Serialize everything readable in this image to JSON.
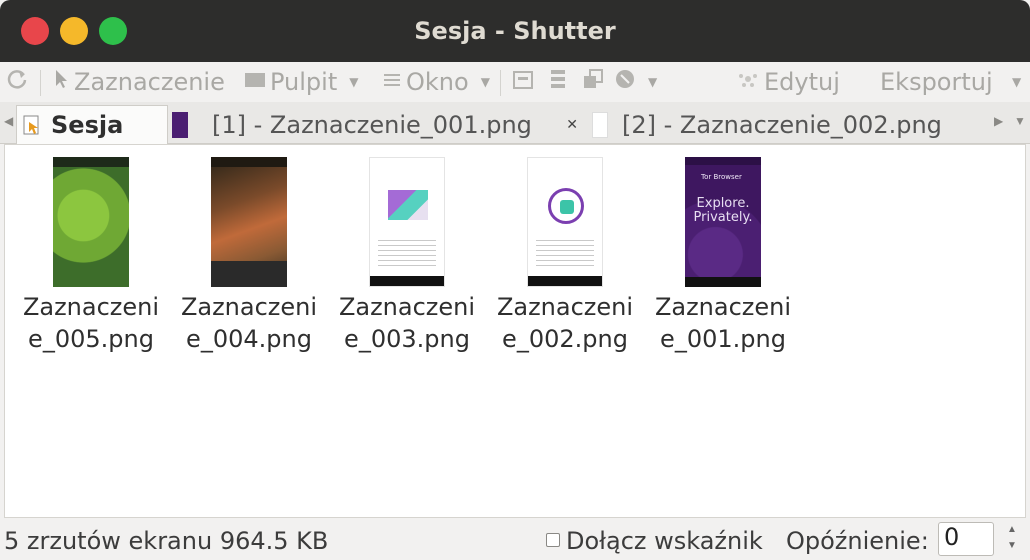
{
  "window": {
    "title": "Sesja - Shutter"
  },
  "toolbar": {
    "selection_label": "Zaznaczenie",
    "desktop_label": "Pulpit",
    "window_label": "Okno",
    "edit_label": "Edytuj",
    "export_label": "Eksportuj"
  },
  "tabs": [
    {
      "label": "Sesja"
    },
    {
      "label": "[1] - Zaznaczenie_001.png"
    },
    {
      "label": "[2] - Zaznaczenie_002.png"
    }
  ],
  "files": [
    {
      "name": "Zaznaczenie_005.png",
      "thumb": "green-map-game"
    },
    {
      "name": "Zaznaczenie_004.png",
      "thumb": "orange-map-game"
    },
    {
      "name": "Zaznaczenie_003.png",
      "thumb": "browser-welcome"
    },
    {
      "name": "Zaznaczenie_002.png",
      "thumb": "browser-ready"
    },
    {
      "name": "Zaznaczenie_001.png",
      "thumb": "tor-browser-purple"
    }
  ],
  "tor_thumb": {
    "brand": "Tor Browser",
    "headline": "Explore. Privately."
  },
  "status": {
    "count_text": "5 zrzutów ekranu  964.5 KB",
    "cursor_label": "Dołącz wskaźnik",
    "delay_label": "Opóźnienie:",
    "delay_value": "0"
  },
  "colors": {
    "titlebar": "#2d2d2c",
    "close": "#e8464b",
    "minimize": "#f5b82a",
    "maximize": "#2ec04b"
  }
}
